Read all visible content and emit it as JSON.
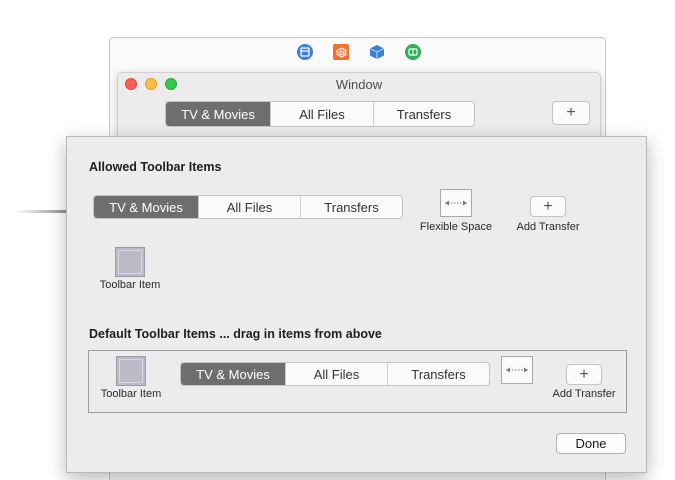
{
  "window": {
    "title": "Window",
    "tabs": [
      "TV & Movies",
      "All Files",
      "Transfers"
    ],
    "active_tab": 0,
    "add_button_label": "+"
  },
  "ib_icons": [
    "first-responder-icon",
    "files-owner-icon",
    "object-cube-icon",
    "application-icon"
  ],
  "sheet": {
    "allowed_heading": "Allowed Toolbar Items",
    "allowed_tabs": [
      "TV & Movies",
      "All Files",
      "Transfers"
    ],
    "flexible_space_label": "Flexible Space",
    "add_transfer_label": "Add Transfer",
    "add_button_label": "+",
    "toolbar_item_label": "Toolbar Item",
    "default_heading": "Default Toolbar Items ... drag in items from above",
    "default_tabs": [
      "TV & Movies",
      "All Files",
      "Transfers"
    ],
    "default_toolbar_item_label": "Toolbar Item",
    "default_add_transfer_label": "Add Transfer",
    "done_label": "Done"
  },
  "colors": {
    "segment_active": "#6e6e6e",
    "swatch": "#bdbac8",
    "close": "#fc605c",
    "minimize": "#fdbc40",
    "zoom": "#34c84a"
  }
}
